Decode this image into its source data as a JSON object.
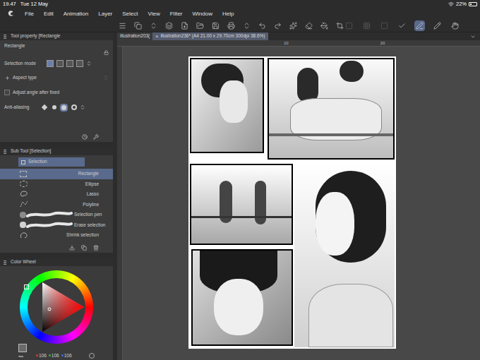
{
  "status_bar": {
    "time": "19.47",
    "date": "Tue 12 May",
    "battery": "22%"
  },
  "menu": [
    "File",
    "Edit",
    "Animation",
    "Layer",
    "Select",
    "View",
    "Filter",
    "Window",
    "Help"
  ],
  "toolbar_tools": [
    {
      "selected": false,
      "disabled": true
    },
    {
      "selected": false,
      "disabled": true
    },
    {
      "selected": false,
      "disabled": true
    },
    {
      "selected": false,
      "disabled": false
    },
    {
      "selected": true,
      "disabled": false
    },
    {
      "selected": false,
      "disabled": false
    },
    {
      "selected": false,
      "disabled": false
    }
  ],
  "document_tabs": [
    {
      "label": "illustration203(",
      "selected": false
    },
    {
      "label": "illustration236* (A4 21.00 x 29.70cm 300dpi 38.6%)",
      "selected": true
    }
  ],
  "tab_close": "×",
  "ruler": [
    "10",
    "20"
  ],
  "tool_property": {
    "title": "Tool property [Rectangle",
    "tool": "Rectangle",
    "selection_mode": {
      "label": "Selection mode",
      "options": [
        {
          "selected": true
        },
        {
          "selected": false
        },
        {
          "selected": false
        },
        {
          "selected": false
        }
      ]
    },
    "aspect_type": {
      "label": "Aspect type",
      "checked": false
    },
    "adjust_angle": {
      "label": "Adjust angle after fixed",
      "checked": false
    },
    "anti_aliasing": {
      "label": "Anti-aliasing",
      "options": [
        {
          "selected": false
        },
        {
          "selected": false
        },
        {
          "selected": true
        },
        {
          "selected": false
        }
      ]
    }
  },
  "sub_tool": {
    "title": "Sub Tool [Selection]",
    "tab": {
      "label": "Selection",
      "selected": true
    },
    "items": [
      {
        "label": "Rectangle",
        "selected": true,
        "kind": "rect"
      },
      {
        "label": "Ellipse",
        "selected": false,
        "kind": "ellipse"
      },
      {
        "label": "Lasso",
        "selected": false,
        "kind": "lasso"
      },
      {
        "label": "Polyline",
        "selected": false,
        "kind": "polyline"
      },
      {
        "label": "Selection pen",
        "selected": false,
        "kind": "pen"
      },
      {
        "label": "Erase selection",
        "selected": false,
        "kind": "erase"
      },
      {
        "label": "Shrink selection",
        "selected": false,
        "kind": "shrink"
      }
    ]
  },
  "color_wheel": {
    "title": "Color Wheel",
    "rgb": [
      "106",
      "106",
      "106"
    ]
  }
}
